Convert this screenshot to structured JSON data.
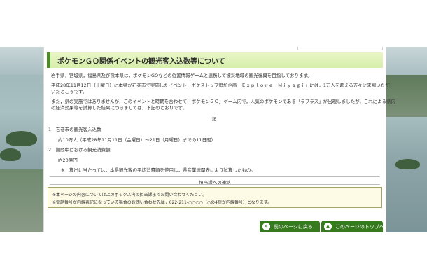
{
  "article": {
    "title": "ポケモンＧＯ関係イベントの観光客入込数等について",
    "paragraphs": [
      "岩手県，宮城県，福島県及び熊本県は，ポケモンGOなどの位置情報ゲームと連携して被災地域の観光復興を目指しております。",
      "平成28年11月12日（土曜日）に本県が石巻市で実施したイベント「ポケストップ追加企画　Ｅｘｐｌｏｒｅ　Ｍｉｙａｇｉ」には，1万人を超える方々に来場いただ",
      "いたところです。",
      "また，県の実施ではありませんが，このイベントと時期を合わせて「ポケモンＧＯ」ゲーム内で，人気のポケモンである「ラプラス」が出現しましたが，これによる県内",
      "の経済効果等を試算した結果につきましては，下記のとおりです。"
    ],
    "ki": "記",
    "section1_title": "1　石巻市の観光客入込数",
    "section1_value": "約10万人（平成28年11月11日（金曜日）～21日（月曜日）までの11日間）",
    "section2_title": "2　期間中における観光消費額",
    "section2_value": "約20億円",
    "note": "※　算出に当たっては，本県観光客の平均消費額を使用し，県産業連関表により試算したもの。"
  },
  "contact": {
    "label": "担当課への連絡",
    "line1": "※本ページの内容については上のボックス内の担当課までお問い合わせください。",
    "line2": "※電話番号が内線表記になっている場合のお問い合わせ先は，022-211-○○○○（○の4桁が内線番号）となります。"
  },
  "nav": {
    "back_label": "前のページに戻る",
    "back_icon": "left-arrow-icon",
    "top_label": "このページのトップへ",
    "top_icon": "up-arrow-icon"
  },
  "colors": {
    "accent": "#357a1d",
    "heading_bg": "#d6eeaa",
    "note_bg": "#fdfbe6"
  }
}
